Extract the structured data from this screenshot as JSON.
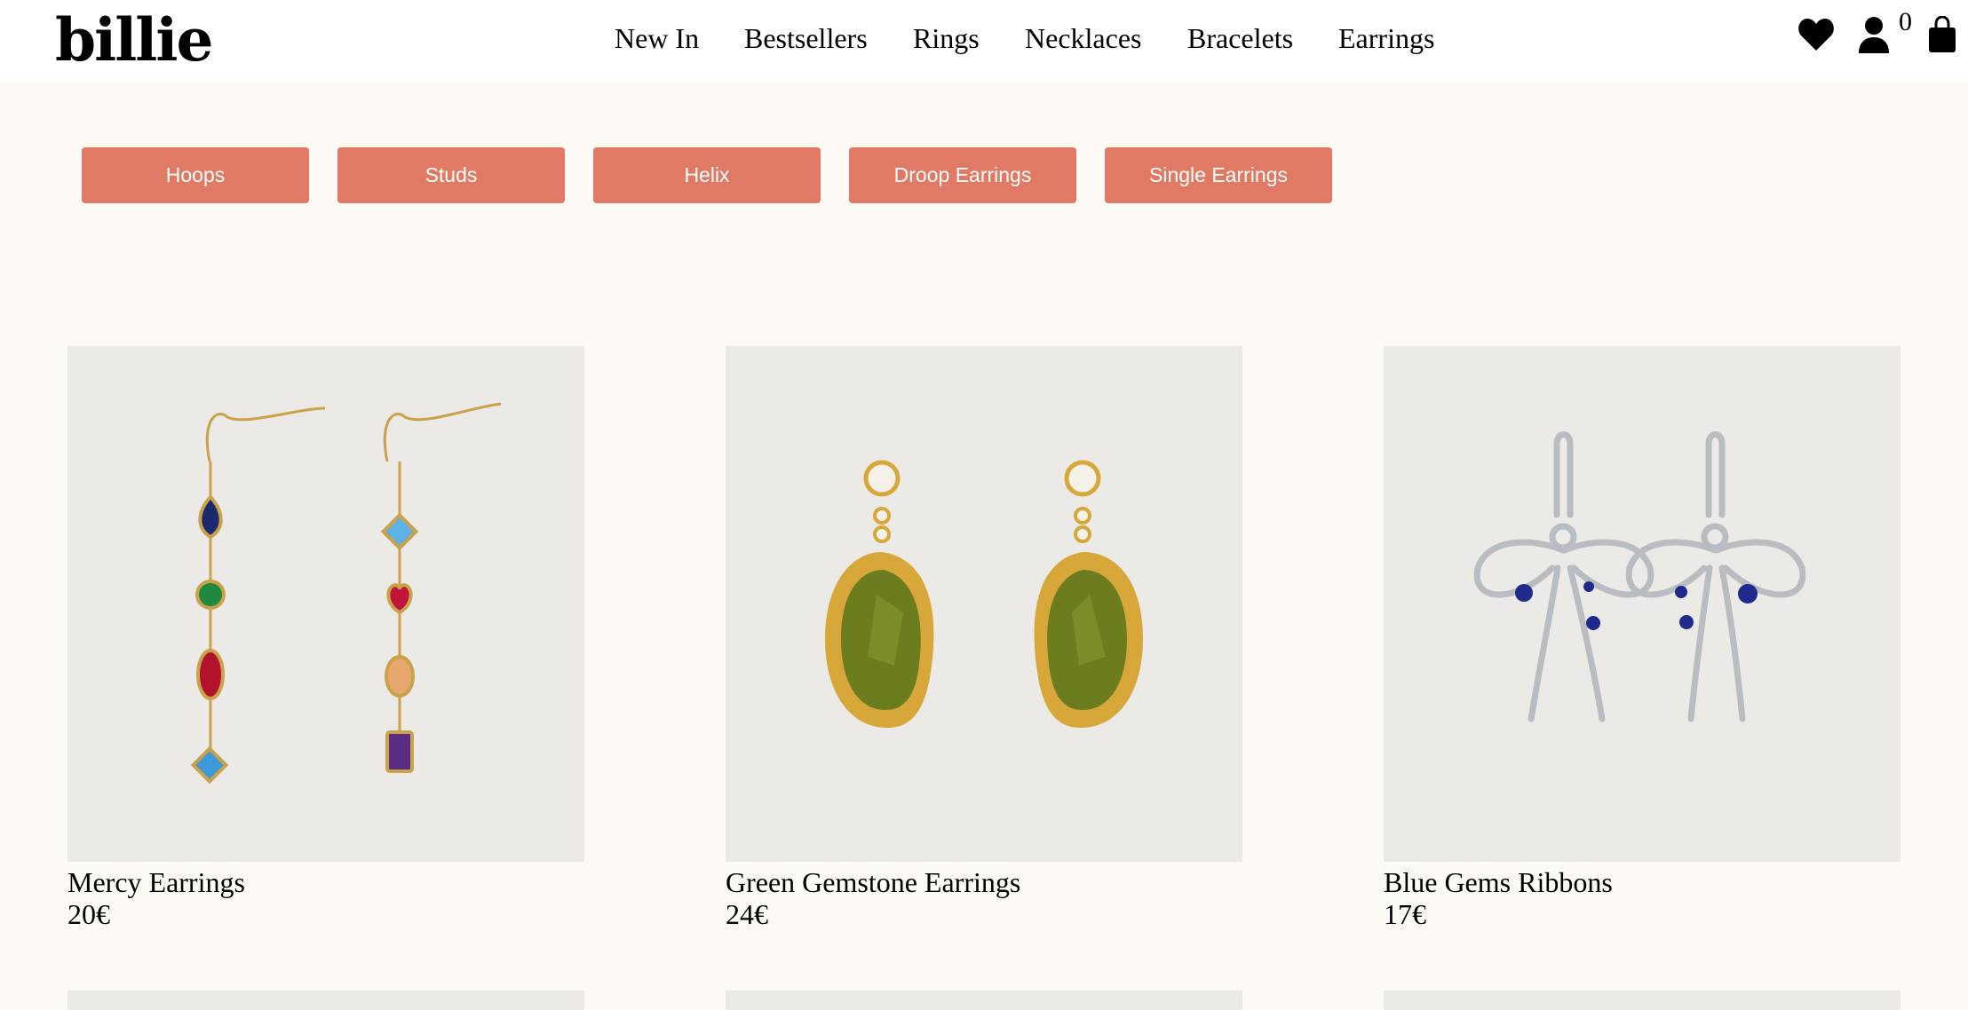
{
  "brand": {
    "logo": "billie"
  },
  "nav": [
    "New In",
    "Bestsellers",
    "Rings",
    "Necklaces",
    "Bracelets",
    "Earrings"
  ],
  "header_icons": {
    "wishlist": "heart-icon",
    "account": "user-icon",
    "cart": "bag-icon",
    "cart_count": "0"
  },
  "filters": [
    "Hoops",
    "Studs",
    "Helix",
    "Droop Earrings",
    "Single Earrings"
  ],
  "products": [
    {
      "name": "Mercy Earrings",
      "price": "20€"
    },
    {
      "name": "Green Gemstone Earrings",
      "price": "24€"
    },
    {
      "name": "Blue Gems Ribbons",
      "price": "17€"
    }
  ],
  "colors": {
    "filter_button": "#e07a65",
    "page_background": "#fdfaf5",
    "image_background": "#ebeae6"
  }
}
